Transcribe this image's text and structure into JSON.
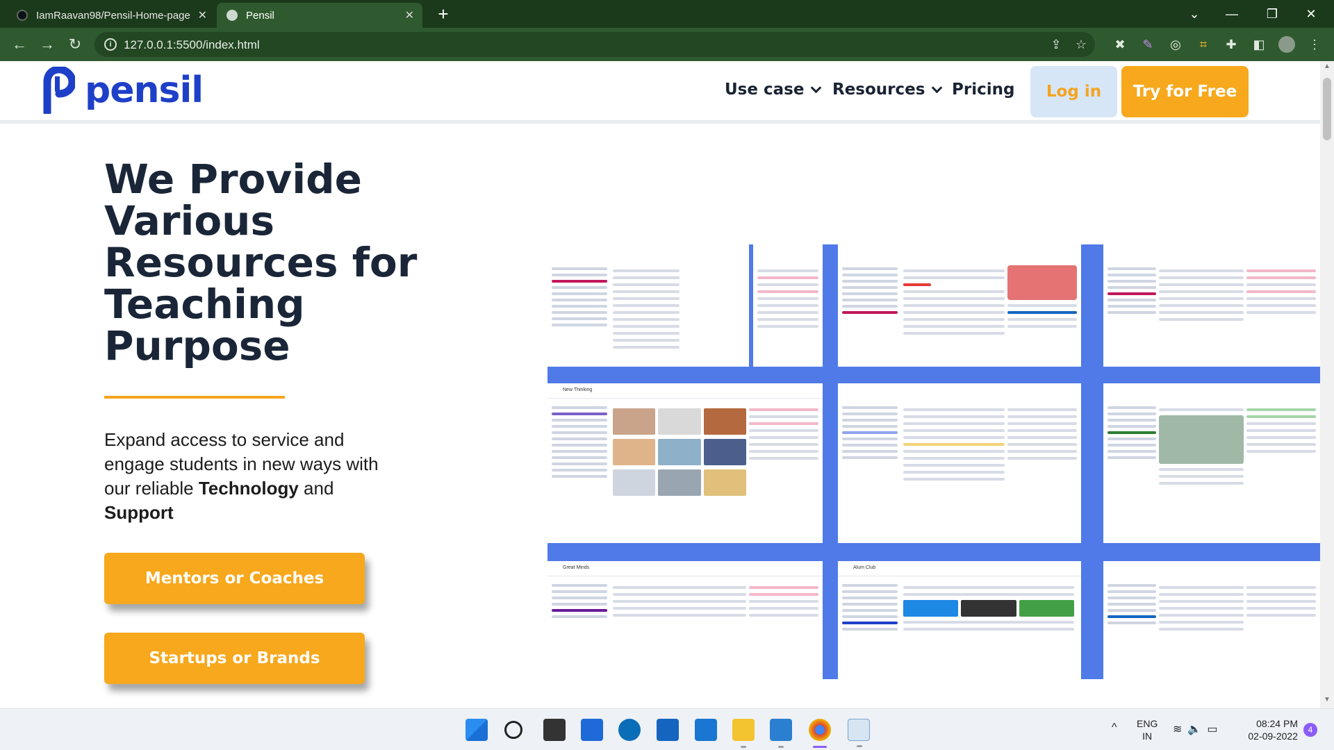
{
  "browser": {
    "tabs": [
      {
        "title": "IamRaavan98/Pensil-Home-page",
        "close": "✕"
      },
      {
        "title": "Pensil",
        "close": "✕"
      }
    ],
    "new_tab": "+",
    "window_controls": {
      "dropdown": "⌄",
      "minimize": "—",
      "restore": "❐",
      "close": "✕"
    },
    "url": "127.0.0.1:5500/index.html",
    "nav": {
      "back": "←",
      "forward": "→",
      "reload": "↻"
    }
  },
  "header": {
    "logo_text": "pensil",
    "nav": [
      {
        "label": "Use case"
      },
      {
        "label": "Resources"
      },
      {
        "label": "Pricing"
      }
    ],
    "login_label": "Log in",
    "try_label": "Try for Free"
  },
  "hero": {
    "title": "We Provide Various Resources for Teaching Purpose",
    "desc_part1": "Expand access to service and engage students in new ways with our reliable ",
    "desc_bold1": "Technology",
    "desc_part2": " and ",
    "desc_bold2": "Support",
    "cta_mentors": "Mentors or Coaches",
    "cta_startups": "Startups or Brands"
  },
  "collage_screens": [
    {
      "label": ""
    },
    {
      "label": ""
    },
    {
      "label": ""
    },
    {
      "label": ""
    },
    {
      "label": "New Thinking"
    },
    {
      "label": ""
    },
    {
      "label": ""
    },
    {
      "label": "Great Minds"
    },
    {
      "label": "Alum Club"
    },
    {
      "label": ""
    }
  ],
  "taskbar": {
    "tray_chevron": "^",
    "language": "ENG",
    "region": "IN",
    "time": "08:24 PM",
    "date": "02-09-2022",
    "notifications": "4"
  },
  "colors": {
    "brand_blue": "#1e40c8",
    "accent_orange": "#f7a81d",
    "chrome_green": "#2f5a2f"
  }
}
